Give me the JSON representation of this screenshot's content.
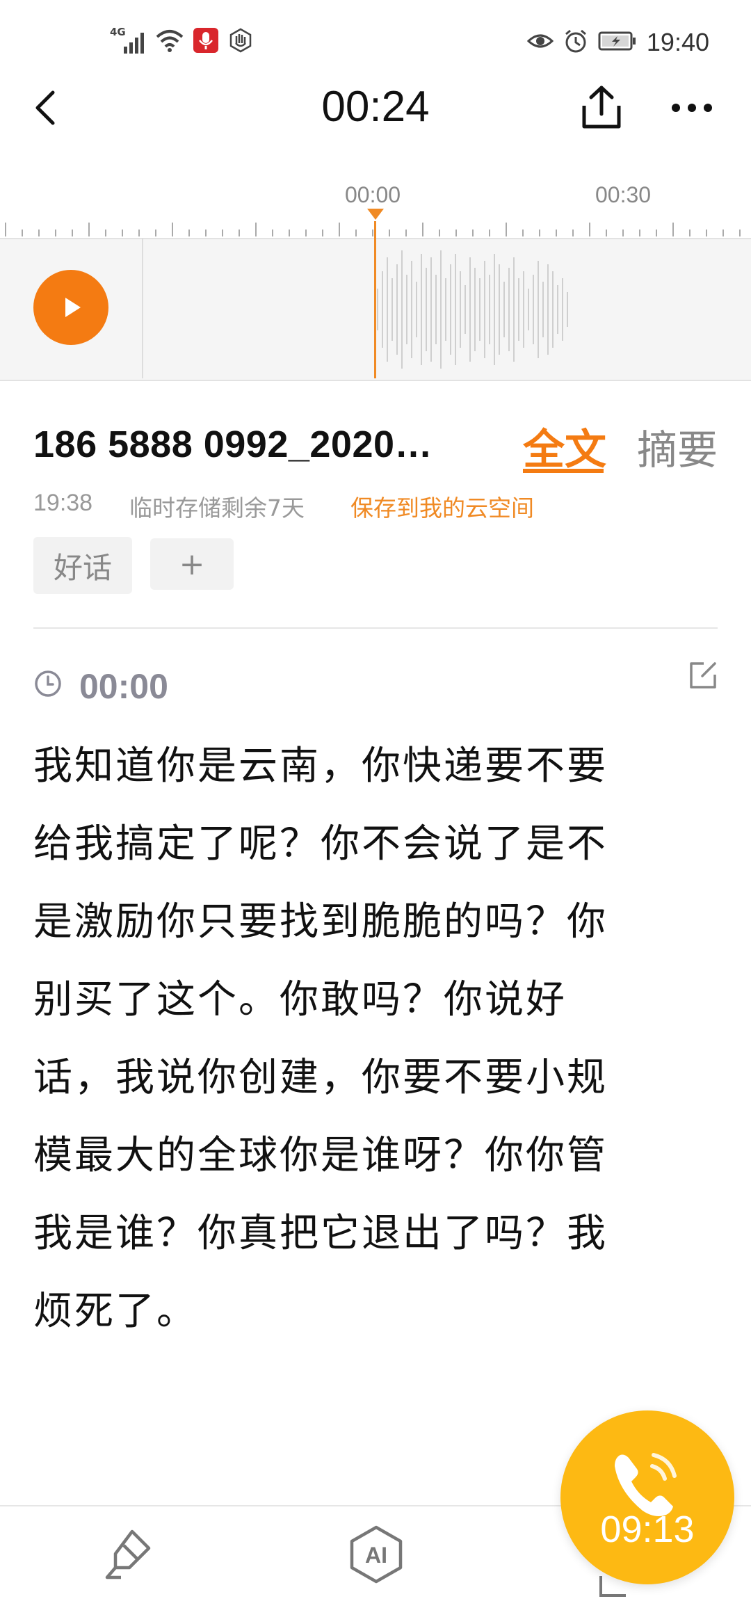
{
  "status_bar": {
    "network": "4G",
    "time": "19:40"
  },
  "header": {
    "back_icon": "chevron-left-icon",
    "title": "00:24",
    "share_icon": "share-icon",
    "more_icon": "more-icon"
  },
  "timeline": {
    "label_start": "00:00",
    "label_next": "00:30",
    "play_icon": "play-icon",
    "accent_color": "#f47b12"
  },
  "file": {
    "title": "186 5888 0992_2020…",
    "tab_full": "全文",
    "tab_summary": "摘要",
    "time": "19:38",
    "storage_note": "临时存储剩余7天",
    "save_link": "保存到我的云空间",
    "tag": "好话",
    "add_tag": "+"
  },
  "transcript": {
    "timestamp": "00:00",
    "lines": [
      "我知道你是云南，你快递要不要",
      "给我搞定了呢？你不会说了是不",
      "是激励你只要找到脆脆的吗？你",
      "别买了这个。你敢吗？你说好",
      "话，我说你创建，你要不要小规",
      "模最大的全球你是谁呀？你你管",
      "我是谁？你真把它退出了吗？我",
      "烦死了。"
    ]
  },
  "call": {
    "timer": "09:13",
    "icon": "phone-icon",
    "color": "#fdb913"
  },
  "bottom_bar": {
    "pen_icon": "highlighter-icon",
    "ai_icon": "ai-icon",
    "ai_text": "AI"
  }
}
